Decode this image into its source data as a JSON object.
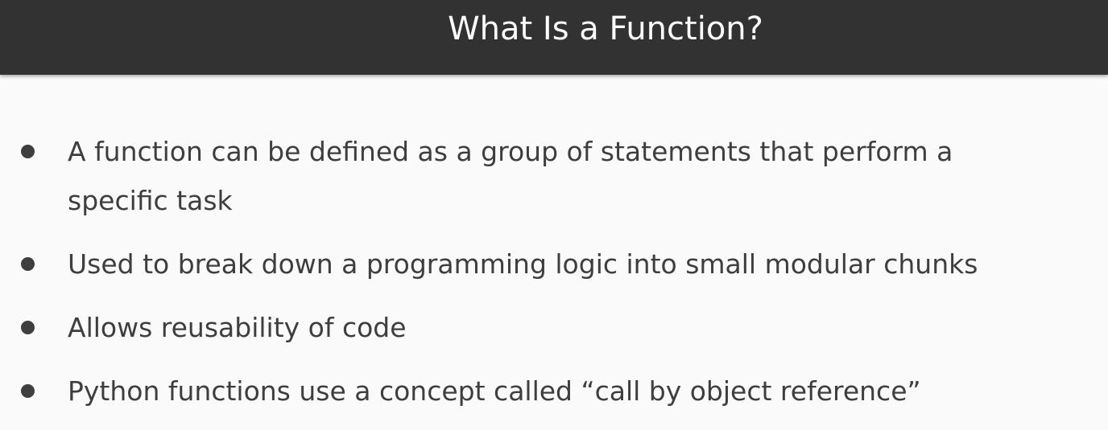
{
  "slide": {
    "title": "What Is a Function?",
    "bullets": [
      "A function can be defined as a group of statements that perform a specific task",
      "Used to break down a programming logic into small modular chunks",
      "Allows reusability of code",
      "Python functions use a concept called “call by object reference”"
    ]
  },
  "colors": {
    "title_bar": "#323232",
    "title_text": "#ffffff",
    "background": "#fafafa",
    "body_text": "#3e3e3e"
  }
}
